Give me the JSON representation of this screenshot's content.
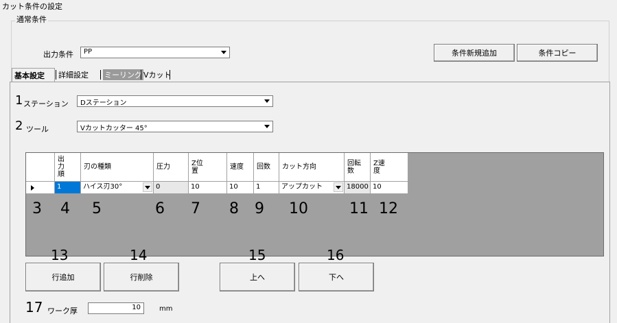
{
  "window_title": "カット条件の設定",
  "group": {
    "label": "通常条件",
    "output_condition_label": "出力条件",
    "output_condition_value": "PP",
    "add_new_button": "条件新規追加",
    "copy_button": "条件コピー"
  },
  "tabs": [
    {
      "label": "基本設定"
    },
    {
      "label": "詳細設定"
    },
    {
      "label": "ミーリング"
    },
    {
      "label": "Vカット"
    }
  ],
  "station": {
    "num": "1",
    "label": "ステーション",
    "value": "Dステーション"
  },
  "tool": {
    "num": "2",
    "label": "ツール",
    "value": "Vカットカッター 45°"
  },
  "grid": {
    "headers": [
      "",
      "出\n力\n順",
      "刃の種類",
      "圧力",
      "Z位\n置",
      "速度",
      "回数",
      "カット方向",
      "回転\n数",
      "Z速\n度"
    ],
    "row": [
      "",
      "1",
      "ハイス刃30°",
      "0",
      "10",
      "10",
      "1",
      "アップカット",
      "18000",
      "10"
    ],
    "col_numbers": [
      "3",
      "4",
      "5",
      "6",
      "7",
      "8",
      "9",
      "10",
      "11",
      "12"
    ]
  },
  "buttons": {
    "add_row": {
      "num": "13",
      "label": "行追加"
    },
    "delete_row": {
      "num": "14",
      "label": "行削除"
    },
    "up": {
      "num": "15",
      "label": "上へ"
    },
    "down": {
      "num": "16",
      "label": "下へ"
    }
  },
  "work_thickness": {
    "num": "17",
    "label": "ワーク厚",
    "value": "10",
    "unit": "mm"
  }
}
